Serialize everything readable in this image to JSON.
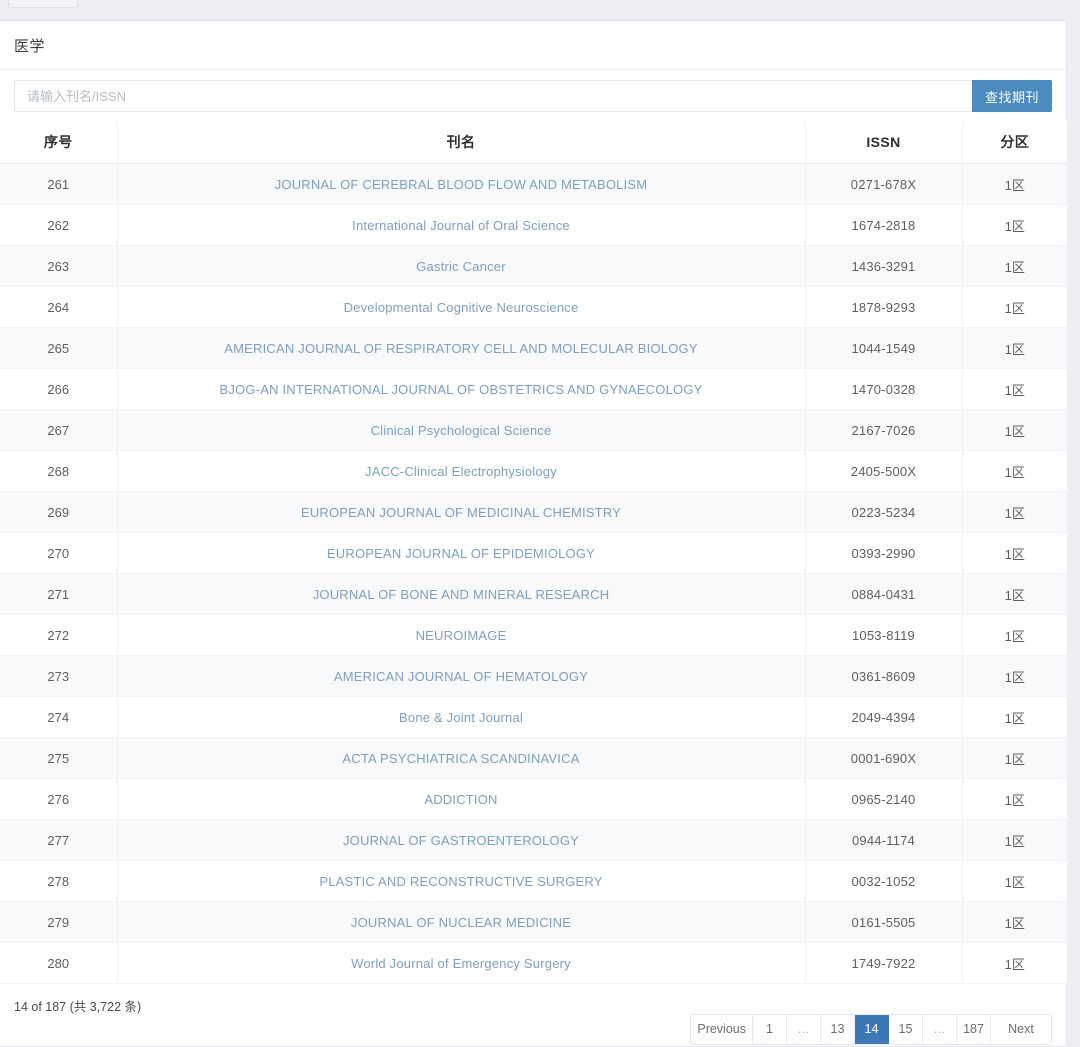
{
  "page": {
    "title": "医学"
  },
  "search": {
    "placeholder": "请输入刊名/ISSN",
    "value": "",
    "button_label": "查找期刊"
  },
  "table": {
    "columns": [
      {
        "key": "index",
        "label": "序号"
      },
      {
        "key": "name",
        "label": "刊名"
      },
      {
        "key": "issn",
        "label": "ISSN"
      },
      {
        "key": "zone",
        "label": "分区"
      }
    ],
    "rows": [
      {
        "index": "261",
        "name": "JOURNAL OF CEREBRAL BLOOD FLOW AND METABOLISM",
        "issn": "0271-678X",
        "zone": "1区"
      },
      {
        "index": "262",
        "name": "International Journal of Oral Science",
        "issn": "1674-2818",
        "zone": "1区"
      },
      {
        "index": "263",
        "name": "Gastric Cancer",
        "issn": "1436-3291",
        "zone": "1区"
      },
      {
        "index": "264",
        "name": "Developmental Cognitive Neuroscience",
        "issn": "1878-9293",
        "zone": "1区"
      },
      {
        "index": "265",
        "name": "AMERICAN JOURNAL OF RESPIRATORY CELL AND MOLECULAR BIOLOGY",
        "issn": "1044-1549",
        "zone": "1区"
      },
      {
        "index": "266",
        "name": "BJOG-AN INTERNATIONAL JOURNAL OF OBSTETRICS AND GYNAECOLOGY",
        "issn": "1470-0328",
        "zone": "1区"
      },
      {
        "index": "267",
        "name": "Clinical Psychological Science",
        "issn": "2167-7026",
        "zone": "1区"
      },
      {
        "index": "268",
        "name": "JACC-Clinical Electrophysiology",
        "issn": "2405-500X",
        "zone": "1区"
      },
      {
        "index": "269",
        "name": "EUROPEAN JOURNAL OF MEDICINAL CHEMISTRY",
        "issn": "0223-5234",
        "zone": "1区"
      },
      {
        "index": "270",
        "name": "EUROPEAN JOURNAL OF EPIDEMIOLOGY",
        "issn": "0393-2990",
        "zone": "1区"
      },
      {
        "index": "271",
        "name": "JOURNAL OF BONE AND MINERAL RESEARCH",
        "issn": "0884-0431",
        "zone": "1区"
      },
      {
        "index": "272",
        "name": "NEUROIMAGE",
        "issn": "1053-8119",
        "zone": "1区"
      },
      {
        "index": "273",
        "name": "AMERICAN JOURNAL OF HEMATOLOGY",
        "issn": "0361-8609",
        "zone": "1区"
      },
      {
        "index": "274",
        "name": "Bone & Joint Journal",
        "issn": "2049-4394",
        "zone": "1区"
      },
      {
        "index": "275",
        "name": "ACTA PSYCHIATRICA SCANDINAVICA",
        "issn": "0001-690X",
        "zone": "1区"
      },
      {
        "index": "276",
        "name": "ADDICTION",
        "issn": "0965-2140",
        "zone": "1区"
      },
      {
        "index": "277",
        "name": "JOURNAL OF GASTROENTEROLOGY",
        "issn": "0944-1174",
        "zone": "1区"
      },
      {
        "index": "278",
        "name": "PLASTIC AND RECONSTRUCTIVE SURGERY",
        "issn": "0032-1052",
        "zone": "1区"
      },
      {
        "index": "279",
        "name": "JOURNAL OF NUCLEAR MEDICINE",
        "issn": "0161-5505",
        "zone": "1区"
      },
      {
        "index": "280",
        "name": "World Journal of Emergency Surgery",
        "issn": "1749-7922",
        "zone": "1区"
      }
    ]
  },
  "footer": {
    "summary": "14 of 187 (共 3,722 条)",
    "pagination": {
      "previous_label": "Previous",
      "next_label": "Next",
      "current_page": "14",
      "items": [
        {
          "label": "Previous",
          "type": "prev"
        },
        {
          "label": "1",
          "type": "page"
        },
        {
          "label": "…",
          "type": "ellipsis"
        },
        {
          "label": "13",
          "type": "page"
        },
        {
          "label": "14",
          "type": "page",
          "active": true
        },
        {
          "label": "15",
          "type": "page"
        },
        {
          "label": "…",
          "type": "ellipsis"
        },
        {
          "label": "187",
          "type": "page"
        },
        {
          "label": "Next",
          "type": "next"
        }
      ]
    }
  },
  "colors": {
    "accent": "#4b8bc0",
    "active_page": "#3b78b5",
    "link": "#7e9fbd",
    "page_background": "#edeff4",
    "card_background": "#ffffff",
    "row_alt_background": "#f8f9fa"
  }
}
